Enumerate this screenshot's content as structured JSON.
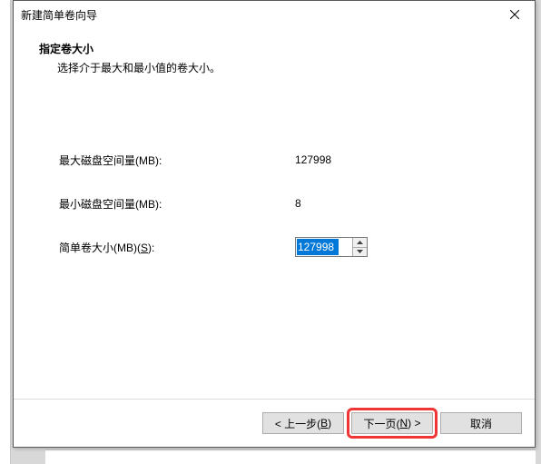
{
  "titlebar": {
    "title": "新建简单卷向导"
  },
  "header": {
    "heading": "指定卷大小",
    "subtext": "选择介于最大和最小值的卷大小。"
  },
  "fields": {
    "max_label": "最大磁盘空间量(MB):",
    "max_value": "127998",
    "min_label": "最小磁盘空间量(MB):",
    "min_value": "8",
    "size_label_pre": "简单卷大小(MB)(",
    "size_label_hotkey": "S",
    "size_label_post": "):",
    "size_value": "127998"
  },
  "buttons": {
    "back_pre": "< 上一步(",
    "back_hotkey": "B",
    "back_post": ")",
    "next_pre": "下一页(",
    "next_hotkey": "N",
    "next_post": ") >",
    "cancel": "取消"
  }
}
